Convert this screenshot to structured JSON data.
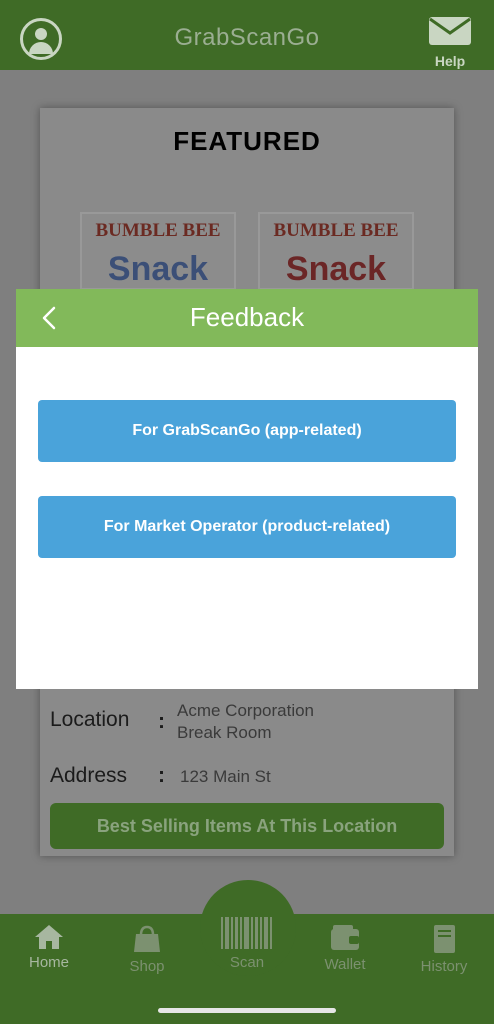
{
  "header": {
    "title": "GrabScanGo",
    "help_label": "Help"
  },
  "featured": {
    "title": "FEATURED",
    "products": [
      {
        "brand": "BUMBLE BEE",
        "name": "Snack"
      },
      {
        "brand": "BUMBLE BEE",
        "name": "Snack"
      }
    ]
  },
  "location_info": {
    "location_label": "Location",
    "location_value_line1": "Acme Corporation",
    "location_value_line2": "Break Room",
    "address_label": "Address",
    "address_value": "123 Main St",
    "separator": ":",
    "best_selling_label": "Best Selling Items At This Location"
  },
  "modal": {
    "title": "Feedback",
    "option_app": "For GrabScanGo (app-related)",
    "option_operator": "For Market Operator (product-related)"
  },
  "nav": {
    "home": "Home",
    "shop": "Shop",
    "scan": "Scan",
    "wallet": "Wallet",
    "history": "History"
  },
  "colors": {
    "brand_green": "#82b95a",
    "button_blue": "#4aa3da",
    "dimmed_green": "#3f6b26"
  }
}
